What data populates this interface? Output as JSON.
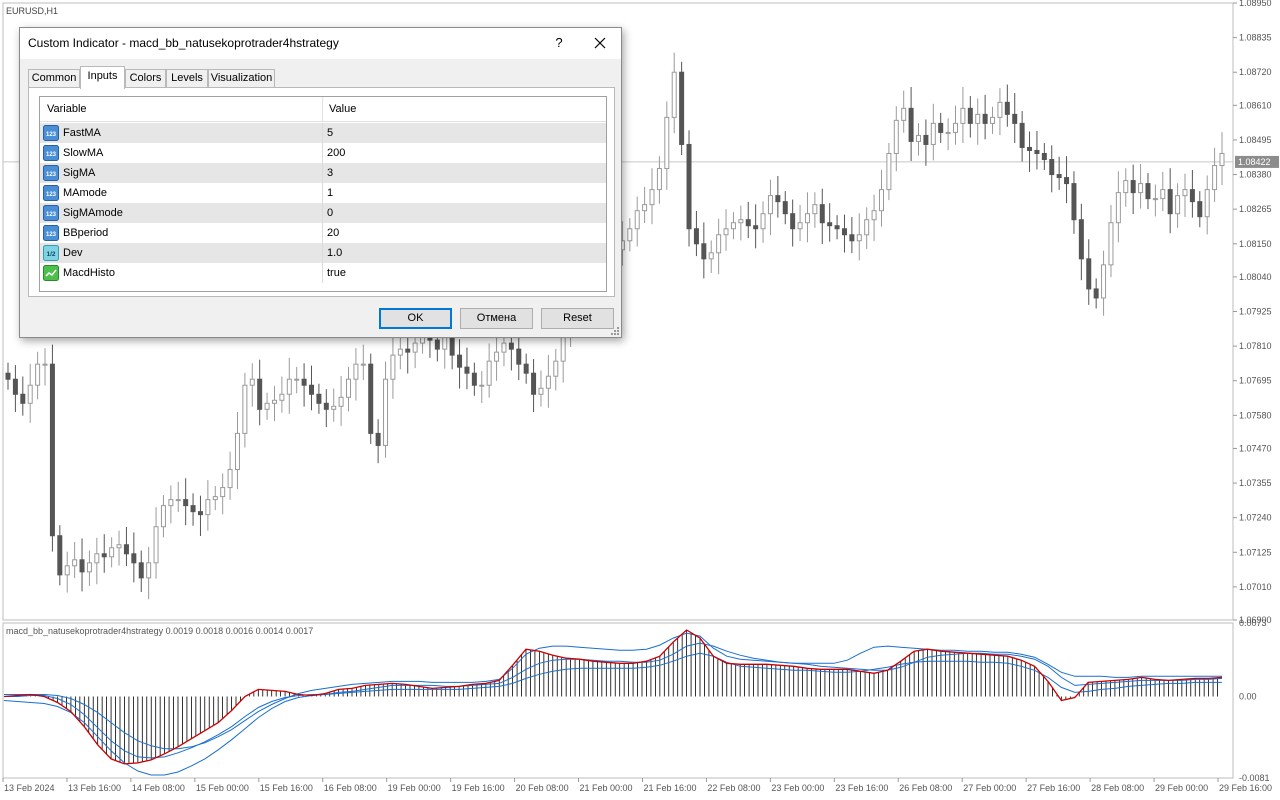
{
  "chart": {
    "symbol_label": "EURUSD,H1",
    "price_axis": [
      "1.08950",
      "1.08835",
      "1.08720",
      "1.08610",
      "1.08495",
      "1.08380",
      "1.08265",
      "1.08150",
      "1.08040",
      "1.07925",
      "1.07810",
      "1.07695",
      "1.07580",
      "1.07470",
      "1.07355",
      "1.07240",
      "1.07125",
      "1.07010",
      "1.06900"
    ],
    "current_price": "1.08422",
    "time_axis": [
      "13 Feb 2024",
      "13 Feb 16:00",
      "14 Feb 08:00",
      "15 Feb 00:00",
      "15 Feb 16:00",
      "16 Feb 08:00",
      "19 Feb 00:00",
      "19 Feb 16:00",
      "20 Feb 08:00",
      "21 Feb 00:00",
      "21 Feb 16:00",
      "22 Feb 08:00",
      "23 Feb 00:00",
      "23 Feb 16:00",
      "26 Feb 08:00",
      "27 Feb 00:00",
      "27 Feb 16:00",
      "28 Feb 08:00",
      "29 Feb 00:00",
      "29 Feb 16:00"
    ],
    "indicator_label": "macd_bb_natusekoprotrader4hstrategy 0.0019 0.0018 0.0016 0.0014 0.0017",
    "indicator_axis": [
      "0.0073",
      "0.00",
      "-0.0081"
    ],
    "colors": {
      "candle": "#9a9a9a",
      "candle_dark": "#555555",
      "macd_line": "#cc0000",
      "bands": "#1a6fd1",
      "histogram": "#000000",
      "price_line": "#c8c8c8"
    }
  },
  "chart_data": {
    "type": "candlestick",
    "symbol": "EURUSD",
    "timeframe": "H1",
    "close": [
      1.077,
      1.0765,
      1.0762,
      1.0768,
      1.0775,
      1.0775,
      1.0718,
      1.0705,
      1.0708,
      1.071,
      1.0706,
      1.0709,
      1.0712,
      1.0711,
      1.0714,
      1.0715,
      1.0712,
      1.0709,
      1.0704,
      1.0709,
      1.0721,
      1.0728,
      1.073,
      1.073,
      1.0728,
      1.0726,
      1.0725,
      1.073,
      1.0731,
      1.0734,
      1.074,
      1.0752,
      1.0768,
      1.077,
      1.076,
      1.0762,
      1.0763,
      1.0765,
      1.077,
      1.077,
      1.0768,
      1.0765,
      1.0762,
      1.076,
      1.0761,
      1.0764,
      1.077,
      1.0775,
      1.0775,
      1.0752,
      1.0748,
      1.077,
      1.0778,
      1.078,
      1.0779,
      1.0782,
      1.0785,
      1.0783,
      1.078,
      1.0785,
      1.0778,
      1.0774,
      1.0772,
      1.0768,
      1.0768,
      1.0776,
      1.0779,
      1.0782,
      1.078,
      1.0775,
      1.0772,
      1.0765,
      1.0767,
      1.0771,
      1.0776,
      1.0786,
      1.0797,
      1.0793,
      1.0796,
      1.0805,
      1.0811,
      1.0814,
      1.0813,
      1.0816,
      1.082,
      1.0826,
      1.0828,
      1.0833,
      1.084,
      1.0857,
      1.0872,
      1.0848,
      1.082,
      1.0815,
      1.081,
      1.0812,
      1.0818,
      1.082,
      1.0822,
      1.0823,
      1.0821,
      1.082,
      1.0825,
      1.0831,
      1.0829,
      1.0825,
      1.082,
      1.0822,
      1.0825,
      1.0828,
      1.0822,
      1.0821,
      1.082,
      1.0818,
      1.0816,
      1.0818,
      1.0823,
      1.0826,
      1.0833,
      1.0845,
      1.0856,
      1.086,
      1.0849,
      1.0851,
      1.0848,
      1.0855,
      1.0852,
      1.0852,
      1.0855,
      1.086,
      1.0855,
      1.0858,
      1.0855,
      1.0857,
      1.0862,
      1.0858,
      1.0855,
      1.0847,
      1.0846,
      1.0845,
      1.0843,
      1.0838,
      1.0837,
      1.0835,
      1.0823,
      1.081,
      1.08,
      1.0797,
      1.0808,
      1.0822,
      1.0832,
      1.0836,
      1.0832,
      1.0835,
      1.083,
      1.083,
      1.0833,
      1.0825,
      1.0831,
      1.0833,
      1.0829,
      1.0824,
      1.0833,
      1.0841,
      1.0845
    ],
    "macd": [
      0.0,
      0.0001,
      0.0002,
      0.0,
      -0.0006,
      -0.0015,
      -0.003,
      -0.0048,
      -0.0062,
      -0.0067,
      -0.0066,
      -0.0063,
      -0.0057,
      -0.005,
      -0.0042,
      -0.0034,
      -0.0026,
      -0.0014,
      0.0,
      0.0007,
      0.0006,
      0.0005,
      0.0002,
      0.0001,
      0.0003,
      0.0007,
      0.0008,
      0.0011,
      0.0012,
      0.0013,
      0.0012,
      0.001,
      0.0008,
      0.0009,
      0.001,
      0.0012,
      0.0013,
      0.0016,
      0.0031,
      0.0047,
      0.0045,
      0.0041,
      0.0038,
      0.0037,
      0.0035,
      0.0034,
      0.0033,
      0.0033,
      0.0035,
      0.004,
      0.0054,
      0.0066,
      0.0058,
      0.004,
      0.0033,
      0.0032,
      0.0032,
      0.0032,
      0.0031,
      0.003,
      0.0028,
      0.0027,
      0.0027,
      0.0027,
      0.0025,
      0.0023,
      0.0026,
      0.0035,
      0.0045,
      0.0047,
      0.0045,
      0.0044,
      0.0043,
      0.0042,
      0.0041,
      0.004,
      0.0036,
      0.003,
      0.0015,
      -0.0004,
      -0.0001,
      0.0014,
      0.0015,
      0.0016,
      0.0017,
      0.0019,
      0.0017,
      0.0016,
      0.0017,
      0.0018,
      0.0018,
      0.0019
    ],
    "signal": [
      0.0,
      0.0,
      0.0001,
      0.0001,
      -0.0002,
      -0.0008,
      -0.0018,
      -0.0031,
      -0.0044,
      -0.0054,
      -0.006,
      -0.0061,
      -0.006,
      -0.0056,
      -0.0051,
      -0.0045,
      -0.0038,
      -0.003,
      -0.002,
      -0.0011,
      -0.0005,
      -0.0001,
      0.0001,
      0.0002,
      0.0002,
      0.0004,
      0.0005,
      0.0007,
      0.0009,
      0.0011,
      0.0011,
      0.0011,
      0.0011,
      0.001,
      0.001,
      0.0011,
      0.0012,
      0.0013,
      0.0019,
      0.0027,
      0.0033,
      0.0036,
      0.0037,
      0.0037,
      0.0036,
      0.0035,
      0.0035,
      0.0034,
      0.0034,
      0.0036,
      0.0042,
      0.005,
      0.0053,
      0.005,
      0.0045,
      0.0041,
      0.0038,
      0.0036,
      0.0034,
      0.0033,
      0.0032,
      0.003,
      0.0029,
      0.0028,
      0.0027,
      0.0026,
      0.0026,
      0.0029,
      0.0034,
      0.0039,
      0.0041,
      0.0042,
      0.0043,
      0.0043,
      0.0042,
      0.0042,
      0.004,
      0.0037,
      0.003,
      0.0019,
      0.0011,
      0.0012,
      0.0013,
      0.0014,
      0.0015,
      0.0016,
      0.0016,
      0.0016,
      0.0016,
      0.0017,
      0.0017,
      0.0018
    ],
    "upper_band": [
      0.0002,
      0.0002,
      0.0002,
      0.0002,
      0.0001,
      -0.0002,
      -0.0008,
      -0.0016,
      -0.0026,
      -0.0036,
      -0.0044,
      -0.0049,
      -0.0052,
      -0.0052,
      -0.005,
      -0.0046,
      -0.004,
      -0.0033,
      -0.0024,
      -0.0015,
      -0.0008,
      -0.0002,
      0.0003,
      0.0006,
      0.0008,
      0.001,
      0.0012,
      0.0013,
      0.0014,
      0.0015,
      0.0015,
      0.0015,
      0.0014,
      0.0014,
      0.0014,
      0.0014,
      0.0015,
      0.0017,
      0.0028,
      0.0042,
      0.0048,
      0.005,
      0.005,
      0.0049,
      0.0048,
      0.0047,
      0.0046,
      0.0046,
      0.0047,
      0.0051,
      0.0058,
      0.0063,
      0.006,
      0.0048,
      0.004,
      0.0037,
      0.0036,
      0.0035,
      0.0034,
      0.0033,
      0.0033,
      0.0033,
      0.0033,
      0.0036,
      0.0043,
      0.0049,
      0.005,
      0.0049,
      0.0048,
      0.0047,
      0.0046,
      0.0046,
      0.0045,
      0.0045,
      0.0044,
      0.0044,
      0.0042,
      0.0039,
      0.0032,
      0.0024,
      0.002,
      0.002,
      0.002,
      0.0019,
      0.0019,
      0.002,
      0.002,
      0.002,
      0.002,
      0.002,
      0.002,
      0.002
    ],
    "lower_band": [
      -0.0004,
      -0.0005,
      -0.0006,
      -0.0007,
      -0.001,
      -0.0016,
      -0.0026,
      -0.004,
      -0.0054,
      -0.0066,
      -0.0074,
      -0.0078,
      -0.0078,
      -0.0075,
      -0.0069,
      -0.0062,
      -0.0053,
      -0.0043,
      -0.0032,
      -0.0021,
      -0.0012,
      -0.0005,
      -0.0001,
      0.0001,
      0.0002,
      0.0003,
      0.0004,
      0.0005,
      0.0006,
      0.0007,
      0.0007,
      0.0007,
      0.0007,
      0.0007,
      0.0007,
      0.0008,
      0.0009,
      0.001,
      0.0013,
      0.0018,
      0.0022,
      0.0025,
      0.0027,
      0.0028,
      0.0028,
      0.0028,
      0.0028,
      0.0028,
      0.0029,
      0.0031,
      0.0035,
      0.004,
      0.0043,
      0.004,
      0.0034,
      0.003,
      0.0029,
      0.0028,
      0.0027,
      0.0026,
      0.0026,
      0.0025,
      0.0024,
      0.0024,
      0.0025,
      0.0027,
      0.0029,
      0.0032,
      0.0034,
      0.0035,
      0.0035,
      0.0035,
      0.0035,
      0.0034,
      0.0034,
      0.0033,
      0.003,
      0.0026,
      0.0019,
      0.0009,
      0.0004,
      0.0005,
      0.0007,
      0.0008,
      0.001,
      0.0011,
      0.0012,
      0.0013,
      0.0013,
      0.0014,
      0.0014,
      0.0014
    ],
    "ylim_price": [
      1.069,
      1.0895
    ],
    "ylim_indicator": [
      -0.0081,
      0.0073
    ]
  },
  "dialog": {
    "title": "Custom Indicator - macd_bb_natusekoprotrader4hstrategy",
    "help_label": "?",
    "tabs": [
      "Common",
      "Inputs",
      "Colors",
      "Levels",
      "Visualization"
    ],
    "active_tab": "Inputs",
    "columns": {
      "variable": "Variable",
      "value": "Value"
    },
    "inputs": [
      {
        "name": "FastMA",
        "value": "5",
        "icon": "integer-icon"
      },
      {
        "name": "SlowMA",
        "value": "200",
        "icon": "integer-icon"
      },
      {
        "name": "SigMA",
        "value": "3",
        "icon": "integer-icon"
      },
      {
        "name": "MAmode",
        "value": "1",
        "icon": "integer-icon"
      },
      {
        "name": "SigMAmode",
        "value": "0",
        "icon": "integer-icon"
      },
      {
        "name": "BBperiod",
        "value": "20",
        "icon": "integer-icon"
      },
      {
        "name": "Dev",
        "value": "1.0",
        "icon": "double-icon"
      },
      {
        "name": "MacdHisto",
        "value": "true",
        "icon": "bool-icon"
      }
    ],
    "buttons": {
      "ok": "OK",
      "cancel": "Отмена",
      "reset": "Reset"
    }
  }
}
